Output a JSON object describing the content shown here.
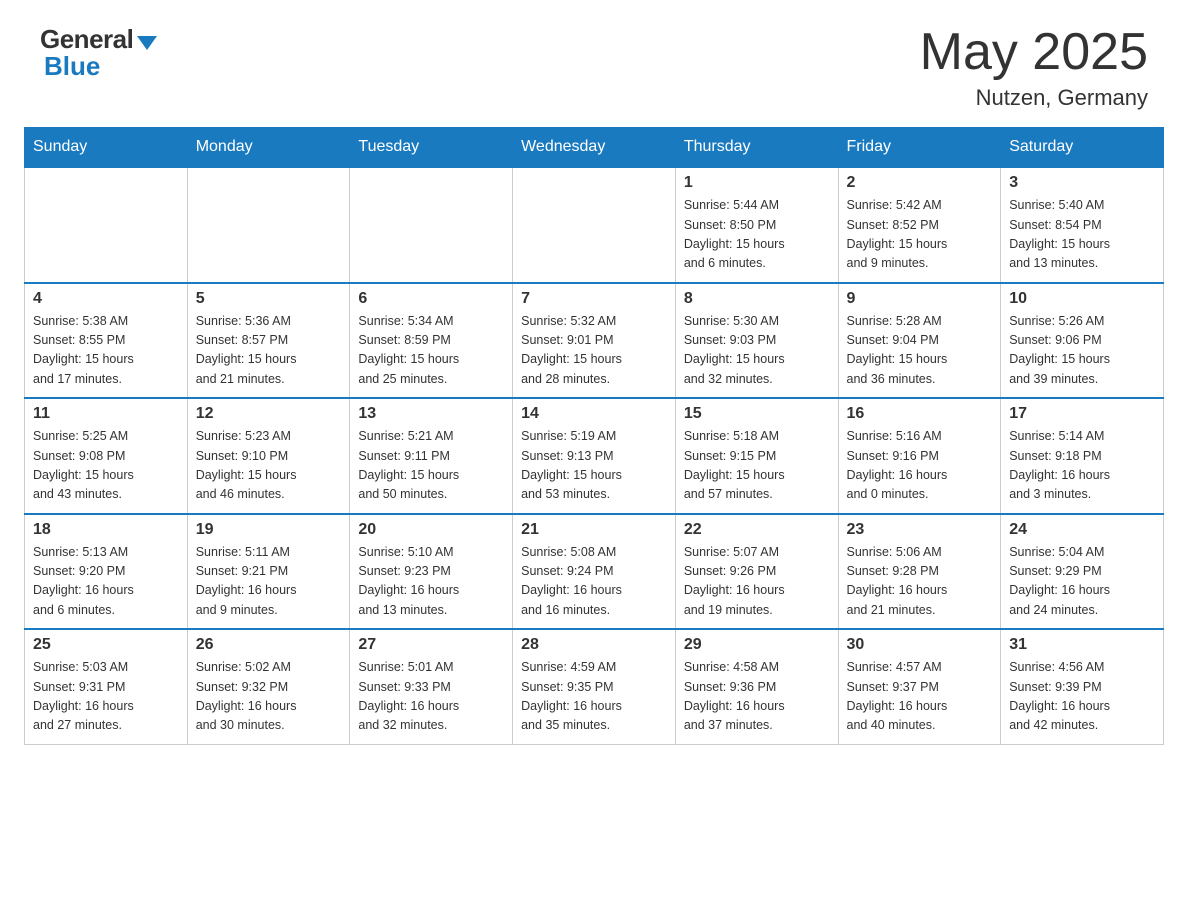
{
  "header": {
    "logo_general": "General",
    "logo_blue": "Blue",
    "month_title": "May 2025",
    "location": "Nutzen, Germany"
  },
  "weekdays": [
    "Sunday",
    "Monday",
    "Tuesday",
    "Wednesday",
    "Thursday",
    "Friday",
    "Saturday"
  ],
  "weeks": [
    [
      {
        "day": "",
        "info": ""
      },
      {
        "day": "",
        "info": ""
      },
      {
        "day": "",
        "info": ""
      },
      {
        "day": "",
        "info": ""
      },
      {
        "day": "1",
        "info": "Sunrise: 5:44 AM\nSunset: 8:50 PM\nDaylight: 15 hours\nand 6 minutes."
      },
      {
        "day": "2",
        "info": "Sunrise: 5:42 AM\nSunset: 8:52 PM\nDaylight: 15 hours\nand 9 minutes."
      },
      {
        "day": "3",
        "info": "Sunrise: 5:40 AM\nSunset: 8:54 PM\nDaylight: 15 hours\nand 13 minutes."
      }
    ],
    [
      {
        "day": "4",
        "info": "Sunrise: 5:38 AM\nSunset: 8:55 PM\nDaylight: 15 hours\nand 17 minutes."
      },
      {
        "day": "5",
        "info": "Sunrise: 5:36 AM\nSunset: 8:57 PM\nDaylight: 15 hours\nand 21 minutes."
      },
      {
        "day": "6",
        "info": "Sunrise: 5:34 AM\nSunset: 8:59 PM\nDaylight: 15 hours\nand 25 minutes."
      },
      {
        "day": "7",
        "info": "Sunrise: 5:32 AM\nSunset: 9:01 PM\nDaylight: 15 hours\nand 28 minutes."
      },
      {
        "day": "8",
        "info": "Sunrise: 5:30 AM\nSunset: 9:03 PM\nDaylight: 15 hours\nand 32 minutes."
      },
      {
        "day": "9",
        "info": "Sunrise: 5:28 AM\nSunset: 9:04 PM\nDaylight: 15 hours\nand 36 minutes."
      },
      {
        "day": "10",
        "info": "Sunrise: 5:26 AM\nSunset: 9:06 PM\nDaylight: 15 hours\nand 39 minutes."
      }
    ],
    [
      {
        "day": "11",
        "info": "Sunrise: 5:25 AM\nSunset: 9:08 PM\nDaylight: 15 hours\nand 43 minutes."
      },
      {
        "day": "12",
        "info": "Sunrise: 5:23 AM\nSunset: 9:10 PM\nDaylight: 15 hours\nand 46 minutes."
      },
      {
        "day": "13",
        "info": "Sunrise: 5:21 AM\nSunset: 9:11 PM\nDaylight: 15 hours\nand 50 minutes."
      },
      {
        "day": "14",
        "info": "Sunrise: 5:19 AM\nSunset: 9:13 PM\nDaylight: 15 hours\nand 53 minutes."
      },
      {
        "day": "15",
        "info": "Sunrise: 5:18 AM\nSunset: 9:15 PM\nDaylight: 15 hours\nand 57 minutes."
      },
      {
        "day": "16",
        "info": "Sunrise: 5:16 AM\nSunset: 9:16 PM\nDaylight: 16 hours\nand 0 minutes."
      },
      {
        "day": "17",
        "info": "Sunrise: 5:14 AM\nSunset: 9:18 PM\nDaylight: 16 hours\nand 3 minutes."
      }
    ],
    [
      {
        "day": "18",
        "info": "Sunrise: 5:13 AM\nSunset: 9:20 PM\nDaylight: 16 hours\nand 6 minutes."
      },
      {
        "day": "19",
        "info": "Sunrise: 5:11 AM\nSunset: 9:21 PM\nDaylight: 16 hours\nand 9 minutes."
      },
      {
        "day": "20",
        "info": "Sunrise: 5:10 AM\nSunset: 9:23 PM\nDaylight: 16 hours\nand 13 minutes."
      },
      {
        "day": "21",
        "info": "Sunrise: 5:08 AM\nSunset: 9:24 PM\nDaylight: 16 hours\nand 16 minutes."
      },
      {
        "day": "22",
        "info": "Sunrise: 5:07 AM\nSunset: 9:26 PM\nDaylight: 16 hours\nand 19 minutes."
      },
      {
        "day": "23",
        "info": "Sunrise: 5:06 AM\nSunset: 9:28 PM\nDaylight: 16 hours\nand 21 minutes."
      },
      {
        "day": "24",
        "info": "Sunrise: 5:04 AM\nSunset: 9:29 PM\nDaylight: 16 hours\nand 24 minutes."
      }
    ],
    [
      {
        "day": "25",
        "info": "Sunrise: 5:03 AM\nSunset: 9:31 PM\nDaylight: 16 hours\nand 27 minutes."
      },
      {
        "day": "26",
        "info": "Sunrise: 5:02 AM\nSunset: 9:32 PM\nDaylight: 16 hours\nand 30 minutes."
      },
      {
        "day": "27",
        "info": "Sunrise: 5:01 AM\nSunset: 9:33 PM\nDaylight: 16 hours\nand 32 minutes."
      },
      {
        "day": "28",
        "info": "Sunrise: 4:59 AM\nSunset: 9:35 PM\nDaylight: 16 hours\nand 35 minutes."
      },
      {
        "day": "29",
        "info": "Sunrise: 4:58 AM\nSunset: 9:36 PM\nDaylight: 16 hours\nand 37 minutes."
      },
      {
        "day": "30",
        "info": "Sunrise: 4:57 AM\nSunset: 9:37 PM\nDaylight: 16 hours\nand 40 minutes."
      },
      {
        "day": "31",
        "info": "Sunrise: 4:56 AM\nSunset: 9:39 PM\nDaylight: 16 hours\nand 42 minutes."
      }
    ]
  ]
}
